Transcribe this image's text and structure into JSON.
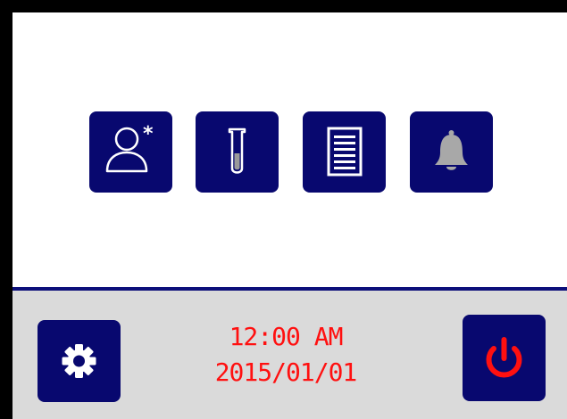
{
  "colors": {
    "tile_bg": "#08086f",
    "bottom_bar_bg": "#dadada",
    "divider": "#0c0f7a",
    "clock_text": "#ff1010",
    "power_icon": "#ff1010",
    "bell_icon": "#a8a8a8"
  },
  "main_menu": {
    "tiles": [
      {
        "name": "user",
        "icon": "user-asterisk-icon"
      },
      {
        "name": "sample",
        "icon": "test-tube-icon"
      },
      {
        "name": "report",
        "icon": "document-list-icon"
      },
      {
        "name": "alarm",
        "icon": "bell-icon"
      }
    ]
  },
  "status_bar": {
    "time": "12:00 AM",
    "date": "2015/01/01",
    "settings_icon": "gear-icon",
    "power_icon": "power-icon"
  }
}
